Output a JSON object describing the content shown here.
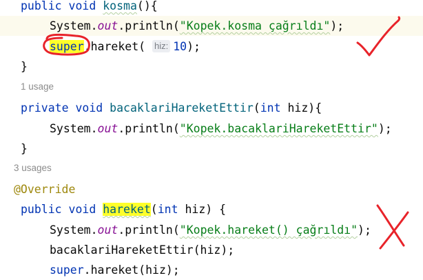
{
  "code": {
    "l1": {
      "kw1": "public",
      "kw2": "void",
      "name": "kosma",
      "rest": "(){"
    },
    "l2": {
      "obj": "System.",
      "field": "out",
      "call": ".println(",
      "str": "\"Kopek.kosma çağrıldı\"",
      "end": ");"
    },
    "l3": {
      "kw": "super",
      "call": ".hareket(",
      "hint": "hiz:",
      "num": "10",
      "end": ");"
    },
    "l4": {
      "text": "}"
    },
    "usage1": "1 usage",
    "l5": {
      "kw1": "private",
      "kw2": "void",
      "name": "bacaklariHareketEttir",
      "open": "(",
      "kw3": "int",
      "param": " hiz",
      "close": "){"
    },
    "l6": {
      "obj": "System.",
      "field": "out",
      "call": ".println(",
      "str": "\"Kopek.bacaklariHareketEttir\"",
      "end": ");"
    },
    "l7": {
      "text": "}"
    },
    "usage3": "3 usages",
    "l8": {
      "ann": "@Override"
    },
    "l9": {
      "kw1": "public",
      "kw2": "void",
      "name": "hareket",
      "open": "(",
      "kw3": "int",
      "param": " hiz) {"
    },
    "l10": {
      "obj": "System.",
      "field": "out",
      "call": ".println(",
      "str": "\"Kopek.hareket() çağrıldı\"",
      "end": ");"
    },
    "l11": {
      "text": "bacaklariHareketEttir(hiz);"
    },
    "l12": {
      "kw": "super",
      "rest": ".hareket(hiz);"
    }
  },
  "annotations": {
    "check_color": "#e8232a",
    "x_color": "#e8232a",
    "circle_color": "#e8232a",
    "highlight_color": "#ffff2a"
  }
}
